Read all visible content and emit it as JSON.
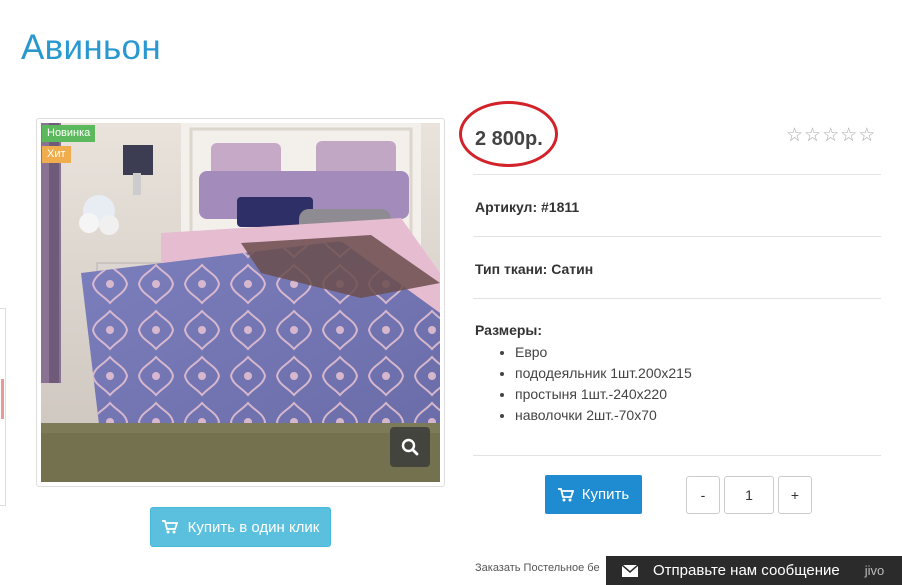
{
  "product": {
    "title": "Авиньон",
    "badges": {
      "new": "Новинка",
      "hit": "Хит"
    },
    "price": "2 800р.",
    "rating": 0,
    "article": "Артикул: #1811",
    "fabric": "Тип ткани: Сатин",
    "sizes_label": "Размеры:",
    "sizes": [
      "Евро",
      "пододеяльник 1шт.200x215",
      "простыня 1шт.-240x220",
      "наволочки 2шт.-70x70"
    ]
  },
  "actions": {
    "buy_label": "Купить",
    "oneclick_label": "Купить в один клик",
    "qty_minus": "-",
    "qty_plus": "+",
    "qty_value": "1"
  },
  "footer": {
    "order_text": "Заказать Постельное бе",
    "message_label": "Отправьте нам сообщение",
    "message_extra": "jivo"
  },
  "colors": {
    "title": "#2a98d0",
    "buy_button": "#1f8bd0",
    "oneclick_button": "#5bc0de",
    "badge_new": "#5cb85c",
    "badge_hit": "#f0ad4e",
    "price_highlight": "#d2232a",
    "chat_bar": "#2b2b2b"
  },
  "icons": {
    "zoom": "search-icon",
    "cart": "cart-icon",
    "message": "envelope-icon",
    "rating": "star-outline-icon"
  }
}
